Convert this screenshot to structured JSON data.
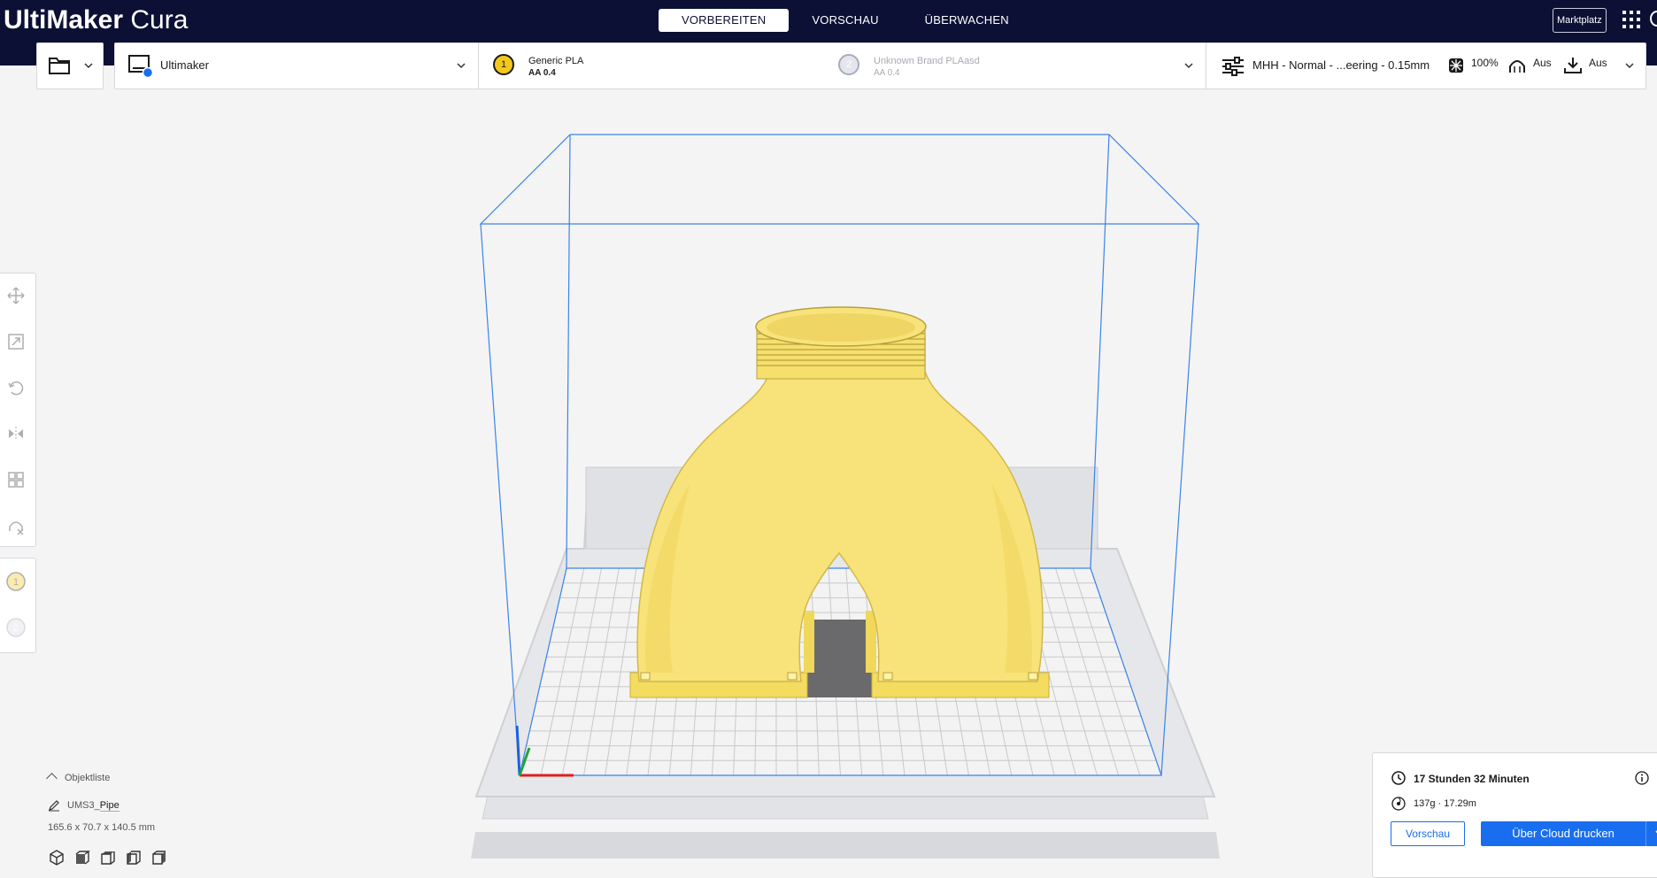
{
  "app": {
    "brand": "UltiMaker",
    "product": "Cura"
  },
  "stages": [
    {
      "label": "VORBEREITEN",
      "active": true
    },
    {
      "label": "VORSCHAU",
      "active": false
    },
    {
      "label": "ÜBERWACHEN",
      "active": false
    }
  ],
  "header": {
    "marketplace_label": "Marktplatz"
  },
  "machine": {
    "name": "Ultimaker"
  },
  "extruders": [
    {
      "index": "1",
      "material": "Generic PLA",
      "nozzle": "AA 0.4",
      "color": "#f3c81c",
      "enabled": true
    },
    {
      "index": "2",
      "material": "Unknown Brand PLAasd",
      "nozzle": "AA 0.4",
      "color": "#e4e6ee",
      "enabled": false
    }
  ],
  "profile": {
    "name": "MHH - Normal - ...eering - 0.15mm",
    "infill": "100%",
    "support": "Aus",
    "adhesion": "Aus"
  },
  "object_list": {
    "title": "Objektliste",
    "object_prefix": "UMS3_",
    "object_name": "Pipe",
    "dimensions": "165.6 x 70.7 x 140.5 mm"
  },
  "print": {
    "time": "17 Stunden 32 Minuten",
    "material": "137g · 17.29m",
    "preview_label": "Vorschau",
    "cloud_label": "Über Cloud drucken"
  },
  "colors": {
    "header": "#0c1035",
    "accent": "#196ef0",
    "model": "#f8e37a",
    "build_volume": "#3a84e8"
  }
}
